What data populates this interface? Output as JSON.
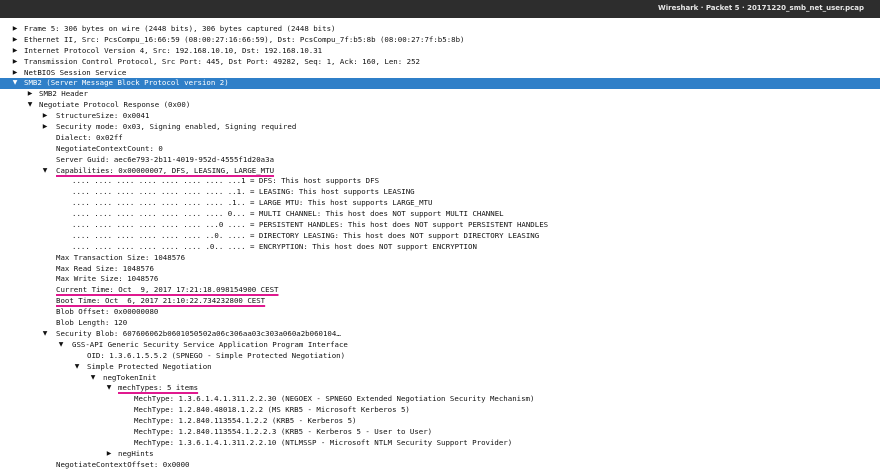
{
  "window": {
    "title": "Wireshark · Packet 5 · 20171220_smb_net_user.pcap"
  },
  "tree": {
    "frame": "Frame 5: 306 bytes on wire (2448 bits), 306 bytes captured (2448 bits)",
    "ethernet": "Ethernet II, Src: PcsCompu_16:66:59 (08:00:27:16:66:59), Dst: PcsCompu_7f:b5:8b (08:00:27:7f:b5:8b)",
    "ip": "Internet Protocol Version 4, Src: 192.168.10.10, Dst: 192.168.10.31",
    "tcp": "Transmission Control Protocol, Src Port: 445, Dst Port: 49282, Seq: 1, Ack: 160, Len: 252",
    "netbios": "NetBIOS Session Service",
    "smb2": "SMB2 (Server Message Block Protocol version 2)",
    "smb2_header": "SMB2 Header",
    "negotiate_response": "Negotiate Protocol Response (0x00)",
    "structure_size": "StructureSize: 0x0041",
    "security_mode": "Security mode: 0x03, Signing enabled, Signing required",
    "dialect": "Dialect: 0x02ff",
    "negotiate_context_count": "NegotiateContextCount: 0",
    "server_guid": "Server Guid: aec6e793-2b11-4019-952d-4555f1d20a3a",
    "capabilities": "Capabilities: 0x00000007, DFS, LEASING, LARGE_MTU",
    "cap_bits": [
      ".... .... .... .... .... .... .... ...1 = DFS: This host supports DFS",
      ".... .... .... .... .... .... .... ..1. = LEASING: This host supports LEASING",
      ".... .... .... .... .... .... .... .1.. = LARGE MTU: This host supports LARGE_MTU",
      ".... .... .... .... .... .... .... 0... = MULTI CHANNEL: This host does NOT support MULTI CHANNEL",
      ".... .... .... .... .... .... ...0 .... = PERSISTENT HANDLES: This host does NOT support PERSISTENT HANDLES",
      ".... .... .... .... .... .... ..0. .... = DIRECTORY LEASING: This host does NOT support DIRECTORY LEASING",
      ".... .... .... .... .... .... .0.. .... = ENCRYPTION: This host does NOT support ENCRYPTION"
    ],
    "max_transaction_size": "Max Transaction Size: 1048576",
    "max_read_size": "Max Read Size: 1048576",
    "max_write_size": "Max Write Size: 1048576",
    "current_time": "Current Time: Oct  9, 2017 17:21:18.098154900 CEST",
    "boot_time": "Boot Time: Oct  6, 2017 21:10:22.734232800 CEST",
    "blob_offset": "Blob Offset: 0x00000080",
    "blob_length": "Blob Length: 120",
    "security_blob": "Security Blob: 607606062b0601050502a06c306aa03c303a060a2b060104…",
    "gss_api": "GSS-API Generic Security Service Application Program Interface",
    "oid": "OID: 1.3.6.1.5.5.2 (SPNEGO - Simple Protected Negotiation)",
    "simple_protected_negotiation": "Simple Protected Negotiation",
    "neg_token_init": "negTokenInit",
    "mech_types": "mechTypes: 5 items",
    "mech_type_items": [
      "MechType: 1.3.6.1.4.1.311.2.2.30 (NEGOEX - SPNEGO Extended Negotiation Security Mechanism)",
      "MechType: 1.2.840.48018.1.2.2 (MS KRB5 - Microsoft Kerberos 5)",
      "MechType: 1.2.840.113554.1.2.2 (KRB5 - Kerberos 5)",
      "MechType: 1.2.840.113554.1.2.2.3 (KRB5 - Kerberos 5 - User to User)",
      "MechType: 1.3.6.1.4.1.311.2.2.10 (NTLMSSP - Microsoft NTLM Security Support Provider)"
    ],
    "neg_hints": "negHints",
    "negotiate_context_offset": "NegotiateContextOffset: 0x0000"
  },
  "icons": {
    "collapsed": "triangle-right-icon",
    "expanded": "triangle-down-icon"
  },
  "colors": {
    "selection": "#2f7fc8",
    "highlight_underline": "#e0198f",
    "titlebar": "#2d2d2d"
  }
}
